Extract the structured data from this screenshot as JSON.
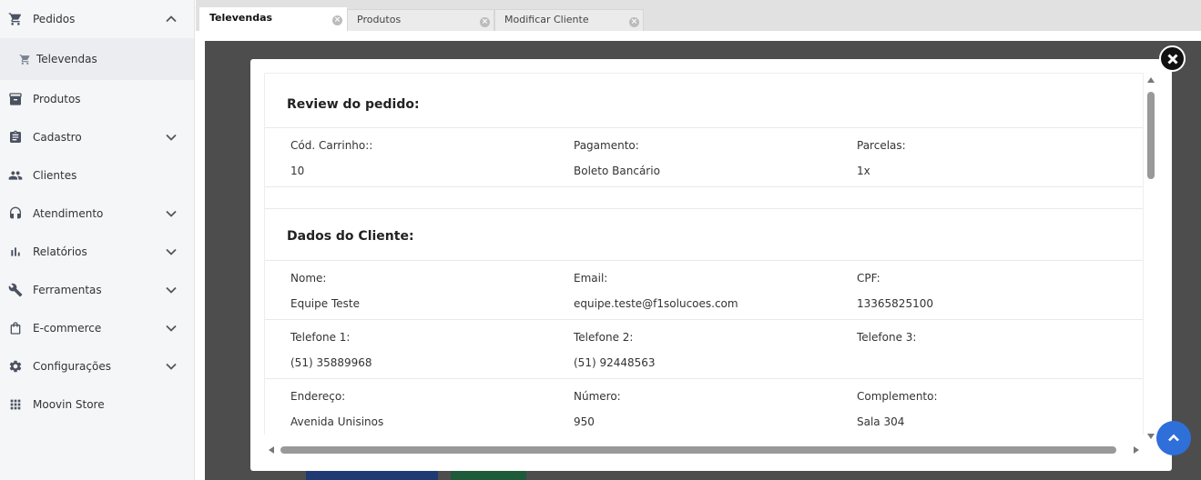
{
  "sidebar": {
    "items": [
      {
        "label": "Pedidos",
        "icon": "cart-icon",
        "expanded": true
      },
      {
        "label": "Televendas",
        "icon": "cart-icon",
        "sub": true
      },
      {
        "label": "Produtos",
        "icon": "archive-icon"
      },
      {
        "label": "Cadastro",
        "icon": "clipboard-icon",
        "has_children": true
      },
      {
        "label": "Clientes",
        "icon": "people-icon"
      },
      {
        "label": "Atendimento",
        "icon": "headset-icon",
        "has_children": true
      },
      {
        "label": "Relatórios",
        "icon": "bar-chart-icon",
        "has_children": true
      },
      {
        "label": "Ferramentas",
        "icon": "wrench-icon",
        "has_children": true
      },
      {
        "label": "E-commerce",
        "icon": "shopping-bag-icon",
        "has_children": true
      },
      {
        "label": "Configurações",
        "icon": "gear-icon",
        "has_children": true
      },
      {
        "label": "Moovin Store",
        "icon": "apps-grid-icon"
      }
    ]
  },
  "tabs": [
    {
      "label": "Televendas",
      "active": true
    },
    {
      "label": "Produtos",
      "active": false
    },
    {
      "label": "Modificar Cliente",
      "active": false
    }
  ],
  "modal": {
    "review_title": "Review do pedido:",
    "review": {
      "cod_label": "Cód. Carrinho::",
      "cod_value": "10",
      "pagamento_label": "Pagamento:",
      "pagamento_value": "Boleto Bancário",
      "parcelas_label": "Parcelas:",
      "parcelas_value": "1x"
    },
    "cliente_title": "Dados do Cliente:",
    "cliente": {
      "nome_label": "Nome:",
      "nome_value": "Equipe Teste",
      "email_label": "Email:",
      "email_value": "equipe.teste@f1solucoes.com",
      "cpf_label": "CPF:",
      "cpf_value": "13365825100",
      "tel1_label": "Telefone 1:",
      "tel1_value": "(51) 35889968",
      "tel2_label": "Telefone 2:",
      "tel2_value": "(51) 92448563",
      "tel3_label": "Telefone 3:",
      "tel3_value": "",
      "endereco_label": "Endereço:",
      "endereco_value": "Avenida Unisinos",
      "numero_label": "Número:",
      "numero_value": "950",
      "complemento_label": "Complemento:",
      "complemento_value": "Sala 304"
    }
  },
  "colors": {
    "sidebar_bg": "#f5f6f8",
    "overlay": "#4d4d4d",
    "back_to_top": "#2f6fd9"
  }
}
